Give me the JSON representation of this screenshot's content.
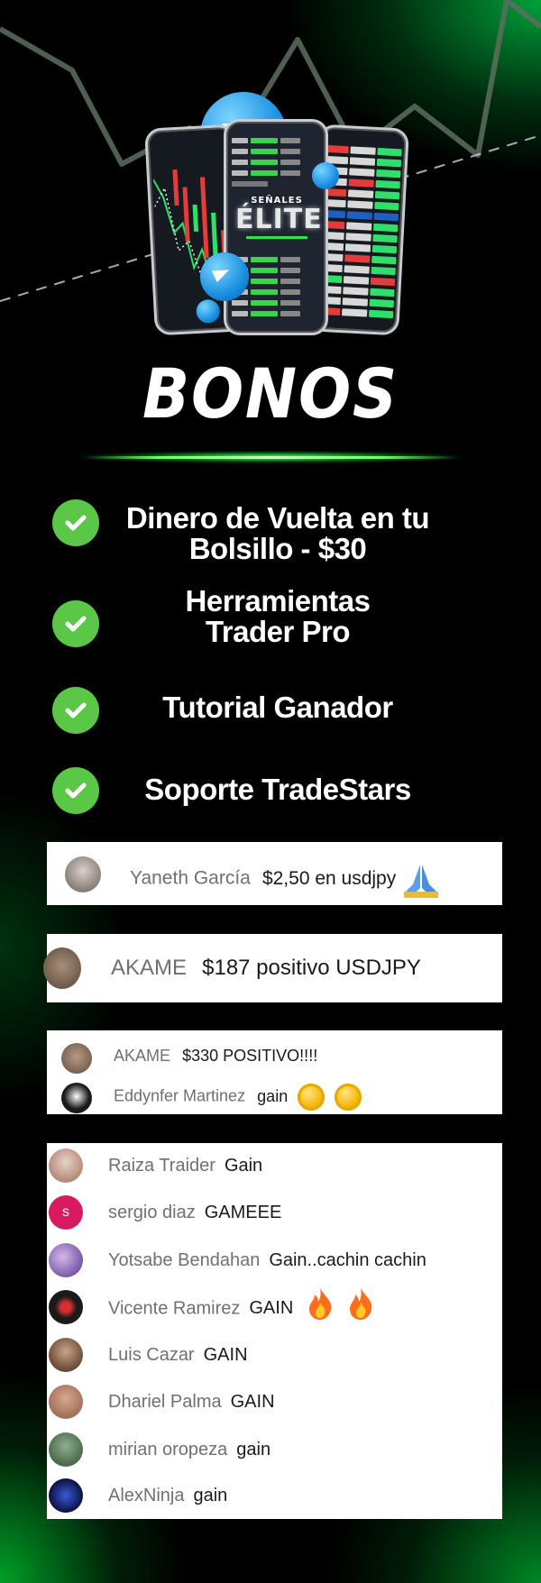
{
  "title": "BONOS",
  "phone": {
    "elite_small": "SEÑALES",
    "elite_big": "ÉLITE"
  },
  "colors": {
    "accent_green": "#2fe34b",
    "check_green": "#5ac747",
    "background": "#000000",
    "card": "#ffffff"
  },
  "bonuses": [
    {
      "line1": "Dinero de Vuelta en tu",
      "line2": "Bolsillo - $30",
      "icon": "check-circle-icon"
    },
    {
      "line1": "Herramientas",
      "line2": "Trader Pro",
      "icon": "check-circle-icon"
    },
    {
      "line1": "Tutorial Ganador",
      "line2": "",
      "icon": "check-circle-icon"
    },
    {
      "line1": "Soporte TradeStars",
      "line2": "",
      "icon": "check-circle-icon"
    }
  ],
  "testimonials": {
    "card1": {
      "name": "Yaneth García",
      "message": "$2,50 en usdjpy",
      "emoji": "folded-hands-icon"
    },
    "card2": {
      "name": "AKAME",
      "message": "$187 positivo USDJPY"
    },
    "card3": [
      {
        "name": "AKAME",
        "message": "$330 POSITIVO!!!!"
      },
      {
        "name": "Eddynfer Martinez",
        "message": "gain",
        "emoji": "coin-icon"
      }
    ],
    "card4": [
      {
        "name": "Raiza Traider",
        "message": "Gain",
        "avatar_color": "#b58a78"
      },
      {
        "name": "sergio diaz",
        "message": "GAMEEE",
        "avatar_color": "#d81b60",
        "avatar_letter": "S"
      },
      {
        "name": "Yotsabe Bendahan",
        "message": "Gain..cachin cachin",
        "avatar_color": "#7a5aa8"
      },
      {
        "name": "Vicente Ramirez",
        "message": "GAIN",
        "avatar_color": "#1a1a1a",
        "emoji": "fire-icon"
      },
      {
        "name": "Luis Cazar",
        "message": "GAIN",
        "avatar_color": "#6b4a35"
      },
      {
        "name": "Dhariel Palma",
        "message": "GAIN",
        "avatar_color": "#a0705a"
      },
      {
        "name": "mirian oropeza",
        "message": "gain",
        "avatar_color": "#4a6a4a"
      },
      {
        "name": "AlexNinja",
        "message": "gain",
        "avatar_color": "#1a2a7a"
      }
    ]
  }
}
